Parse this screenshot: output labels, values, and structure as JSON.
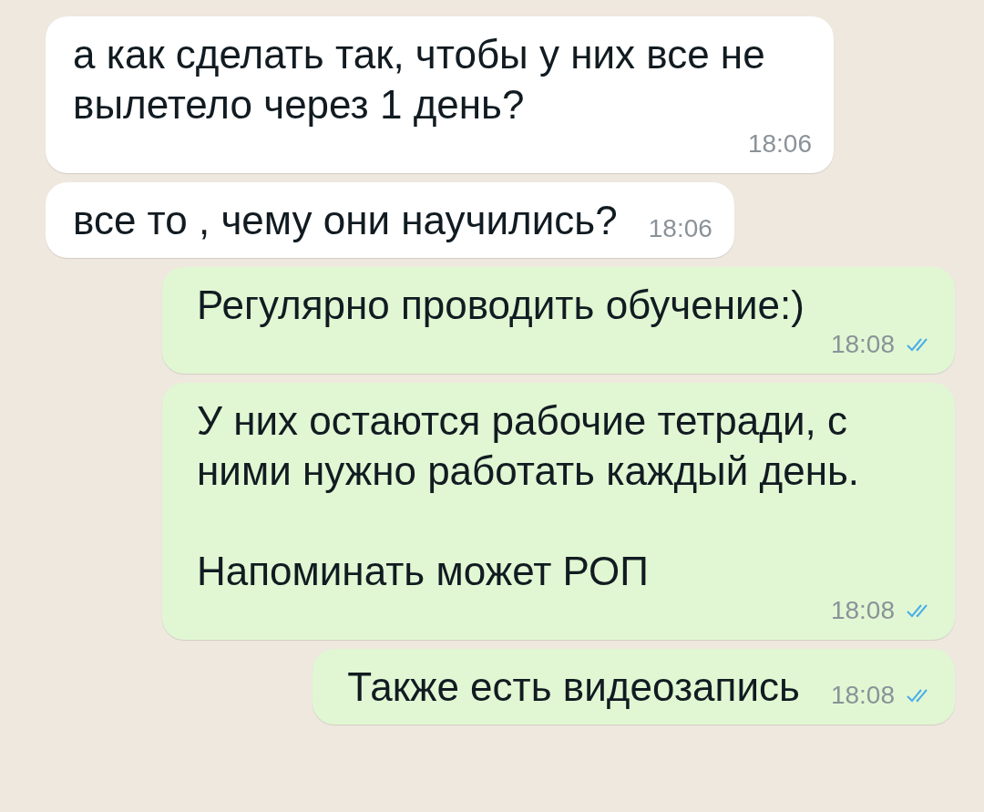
{
  "messages": [
    {
      "kind": "incoming",
      "text": "а как сделать так, чтобы у них все не вылетело через 1 день?",
      "time": "18:06"
    },
    {
      "kind": "incoming",
      "text": "все то , чему они научились?",
      "time": "18:06"
    },
    {
      "kind": "outgoing",
      "text": "Регулярно проводить обучение:)",
      "time": "18:08",
      "read": true
    },
    {
      "kind": "outgoing",
      "text": "У них остаются рабочие тетради, с ними нужно работать каждый день.\n\nНапоминать может РОП",
      "time": "18:08",
      "read": true
    },
    {
      "kind": "outgoing",
      "text": "Также есть видеозапись",
      "time": "18:08",
      "read": true
    }
  ]
}
